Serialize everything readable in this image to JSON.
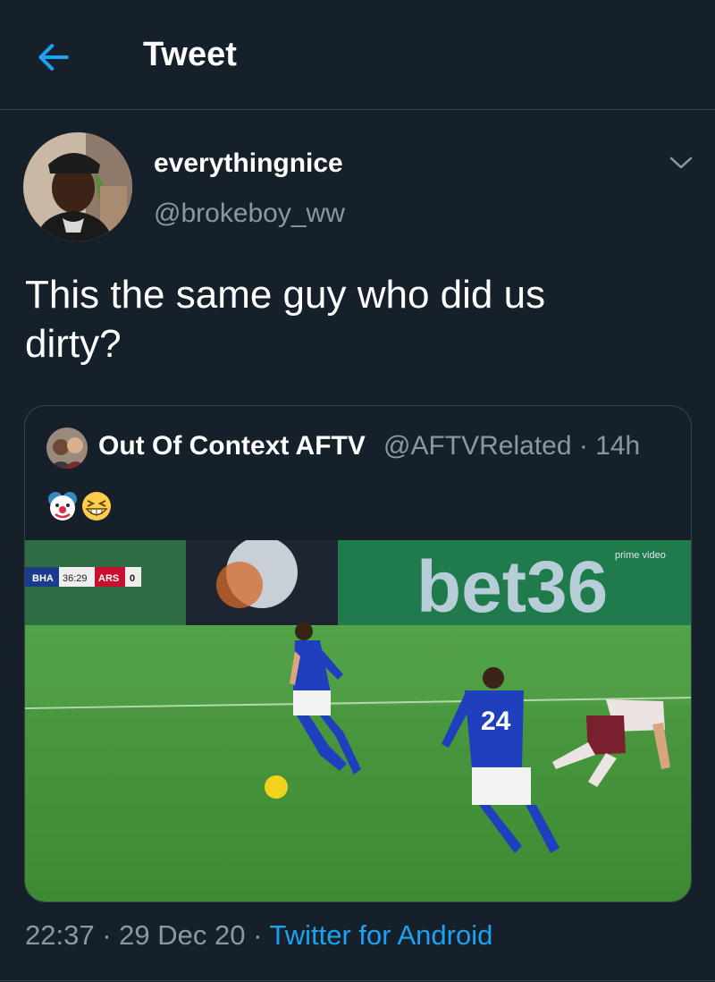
{
  "header": {
    "title": "Tweet",
    "back_icon": "arrow-left-icon"
  },
  "tweet": {
    "display_name": "everythingnice",
    "handle": "@brokeboy_ww",
    "text_line1": "This the same guy who did us",
    "text_line2": "dirty?",
    "menu_icon": "chevron-down-icon"
  },
  "quote": {
    "display_name": "Out Of Context AFTV",
    "handle_time": "@AFTVRelated · 14h",
    "emojis": [
      "clown-face-emoji",
      "grinning-squinting-face-emoji"
    ],
    "video": {
      "scoreboard": {
        "home": "BHA",
        "clock": "36:29",
        "away": "ARS",
        "away_score": "0"
      },
      "ad_board_text": "bet36",
      "watermark": "prime video",
      "player_number": "24"
    }
  },
  "meta": {
    "time": "22:37",
    "date": "29 Dec 20",
    "app": "Twitter for Android"
  },
  "colors": {
    "background": "#15202b",
    "divider": "#38444d",
    "accent": "#1da1f2",
    "secondary_text": "#8899a6"
  }
}
